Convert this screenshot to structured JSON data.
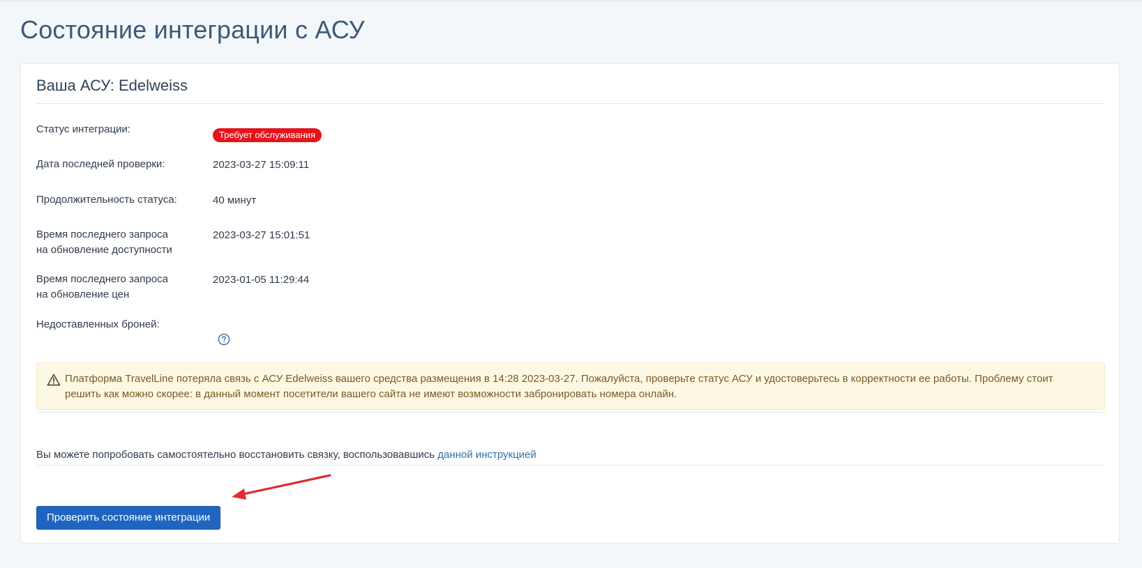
{
  "page": {
    "title": "Состояние интеграции с АСУ"
  },
  "card": {
    "title": "Ваша АСУ: Edelweiss",
    "status": {
      "label": "Статус интеграции:",
      "badge": "Требует обслуживания",
      "badge_color": "#e5131b"
    },
    "last_check": {
      "label": "Дата последней проверки:",
      "value": "2023-03-27 15:09:11"
    },
    "duration": {
      "label": "Продолжительность статуса:",
      "value": "40 минут"
    },
    "availability_request": {
      "label_line1": "Время последнего запроса",
      "label_line2": "на обновление доступности",
      "value": "2023-03-27 15:01:51"
    },
    "prices_request": {
      "label_line1": "Время последнего запроса",
      "label_line2": "на обновление цен",
      "value": "2023-01-05 11:29:44"
    },
    "undelivered": {
      "label": "Недоставленных броней:",
      "icon": "question-circle-icon"
    },
    "alert": {
      "icon": "warning-triangle-icon",
      "text": "Платформа TravelLine потеряла связь с АСУ Edelweiss вашего средства размещения в 14:28 2023-03-27. Пожалуйста, проверьте статус АСУ и удостоверьтесь в корректности ее работы. Проблему стоит решить как можно скорее: в данный момент посетители вашего сайта не имеют возможности забронировать номера онлайн.",
      "background_color": "#fdf8e4",
      "text_color": "#7a5a22"
    },
    "info": {
      "text": "Вы можете попробовать самостоятельно восстановить связку, воспользовавшись ",
      "link_text": "данной инструкцией"
    },
    "check_button": {
      "label": "Проверить состояние интеграции",
      "color": "#1f65c0"
    },
    "annotation_arrow": {
      "icon": "red-arrow-icon",
      "color": "#e02b35"
    }
  }
}
